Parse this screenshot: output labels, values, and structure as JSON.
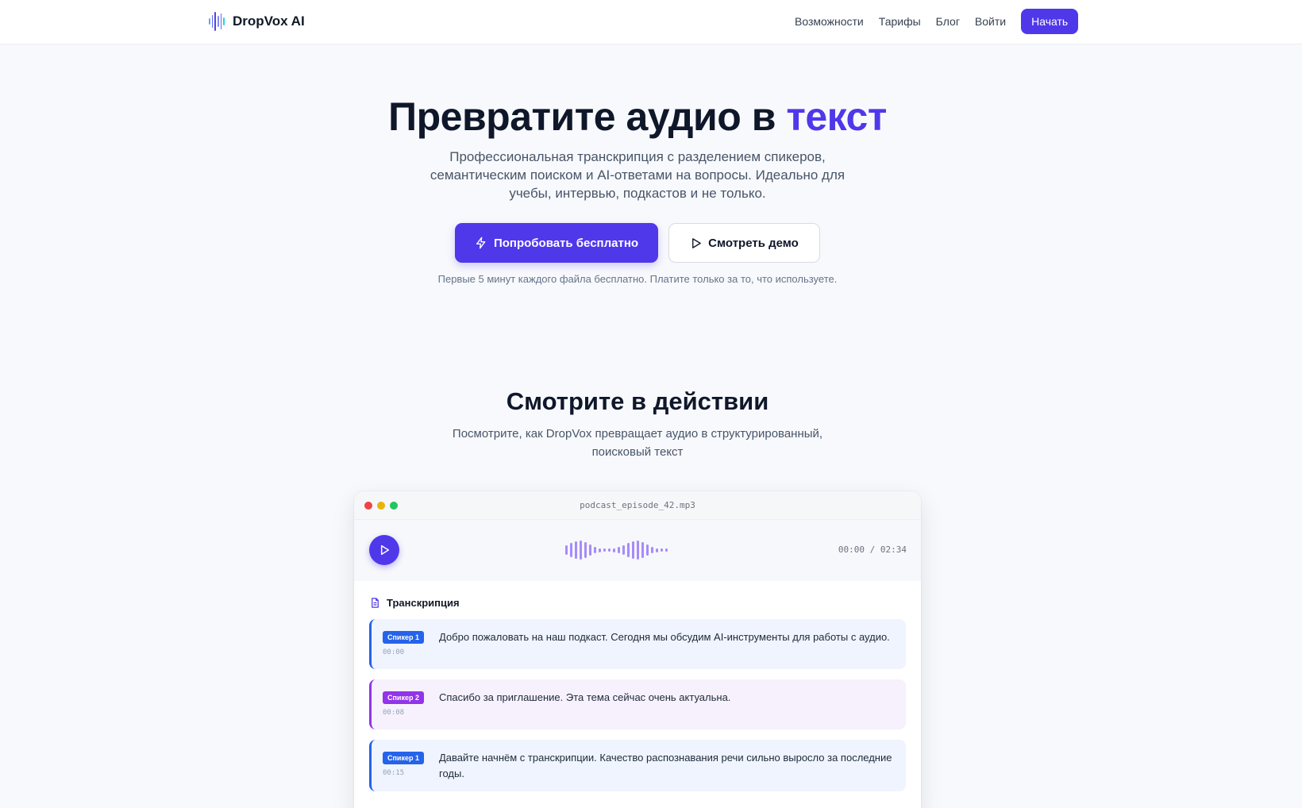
{
  "nav": {
    "brand": "DropVox AI",
    "links": [
      "Возможности",
      "Тарифы",
      "Блог",
      "Войти"
    ],
    "cta": "Начать"
  },
  "hero": {
    "title_main": "Превратите аудио в ",
    "title_accent": "текст",
    "subtitle": "Профессиональная транскрипция с разделением спикеров, семантическим поиском и AI-ответами на вопросы. Идеально для учебы, интервью, подкастов и не только.",
    "primary_button": "Попробовать бесплатно",
    "secondary_button": "Смотреть демо",
    "note": "Первые 5 минут каждого файла бесплатно. Платите только за то, что используете."
  },
  "demo_section": {
    "title": "Смотрите в действии",
    "subtitle": "Посмотрите, как DropVox превращает аудио в структурированный, поисковый текст"
  },
  "demo": {
    "file_name": "podcast_episode_42.mp3",
    "time": "00:00 / 02:34",
    "transcript_title": "Транскрипция",
    "segments": [
      {
        "speaker": "Спикер 1",
        "timestamp": "00:00",
        "text": "Добро пожаловать на наш подкаст. Сегодня мы обсудим AI-инструменты для работы с аудио.",
        "color": "#2563eb",
        "bg": "#eff4fe"
      },
      {
        "speaker": "Спикер 2",
        "timestamp": "00:08",
        "text": "Спасибо за приглашение. Эта тема сейчас очень актуальна.",
        "color": "#9333ea",
        "bg": "#f6f1fd"
      },
      {
        "speaker": "Спикер 1",
        "timestamp": "00:15",
        "text": "Давайте начнём с транскрипции. Качество распознавания речи сильно выросло за последние годы.",
        "color": "#2563eb",
        "bg": "#eff4fe"
      }
    ]
  },
  "colors": {
    "accent": "#4f38ea",
    "speaker1": "#2563eb",
    "speaker2": "#9333ea",
    "wave": "#a78bfa"
  }
}
